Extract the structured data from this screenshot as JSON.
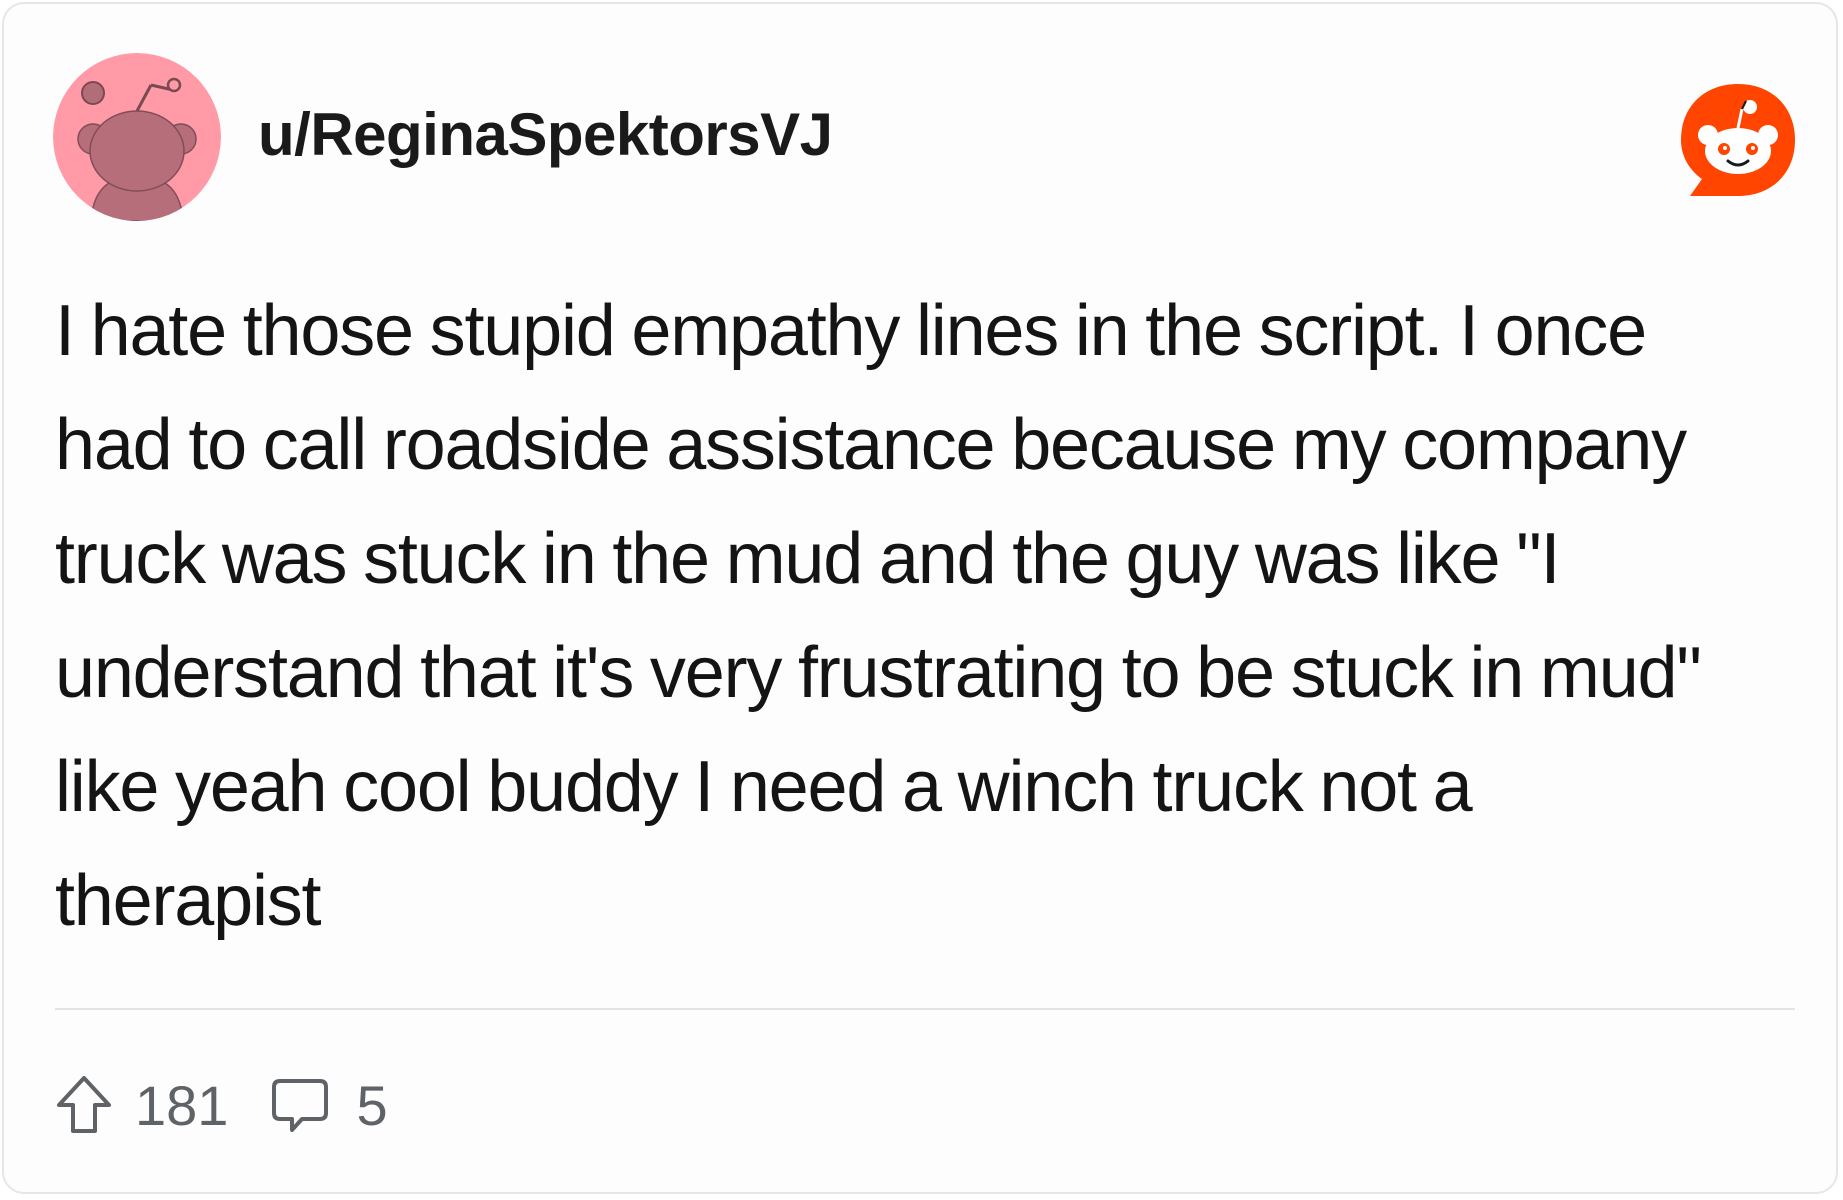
{
  "post": {
    "username": "u/ReginaSpektorsVJ",
    "avatar_icon": "snoo-avatar-icon",
    "avatar_color": "#ff9aa6",
    "brand_icon": "reddit-logo-icon",
    "brand_color": "#ff4500",
    "body_lines": [
      "I hate those stupid empathy lines in the script. I once",
      "had to call roadside assistance because my company",
      "truck was stuck in the mud and the guy was like \"I",
      "understand that it's very frustrating to be stuck in mud\"",
      "like yeah cool buddy I need a winch truck not a",
      "therapist"
    ]
  },
  "actions": {
    "upvote_icon": "upvote-arrow-icon",
    "upvotes": "181",
    "comment_icon": "comment-bubble-icon",
    "comments": "5"
  }
}
